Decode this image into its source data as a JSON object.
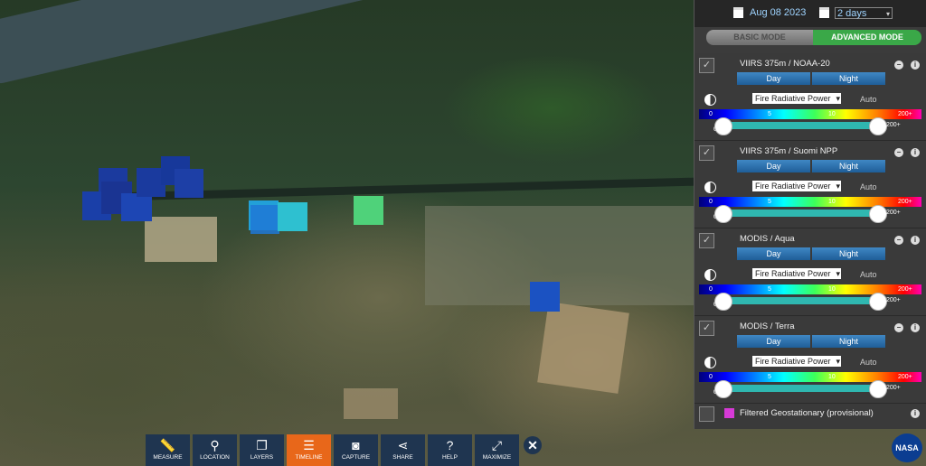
{
  "header": {
    "date": "Aug 08 2023",
    "range": "2 days"
  },
  "modes": {
    "basic": "BASIC MODE",
    "advanced": "ADVANCED MODE"
  },
  "layers": [
    {
      "name": "VIIRS 375m / NOAA-20",
      "day": "Day",
      "night": "Night",
      "metric": "Fire Radiative Power",
      "auto": "Auto",
      "scale": [
        "0",
        "5",
        "10",
        "200+"
      ],
      "slider_min": "0",
      "slider_max": "200+"
    },
    {
      "name": "VIIRS 375m / Suomi NPP",
      "day": "Day",
      "night": "Night",
      "metric": "Fire Radiative Power",
      "auto": "Auto",
      "scale": [
        "0",
        "5",
        "10",
        "200+"
      ],
      "slider_min": "0",
      "slider_max": "200+"
    },
    {
      "name": "MODIS / Aqua",
      "day": "Day",
      "night": "Night",
      "metric": "Fire Radiative Power",
      "auto": "Auto",
      "scale": [
        "0",
        "5",
        "10",
        "200+"
      ],
      "slider_min": "0",
      "slider_max": "200+"
    },
    {
      "name": "MODIS / Terra",
      "day": "Day",
      "night": "Night",
      "metric": "Fire Radiative Power",
      "auto": "Auto",
      "scale": [
        "0",
        "5",
        "10",
        "200+"
      ],
      "slider_min": "0",
      "slider_max": "200+"
    }
  ],
  "filtered_layer": "Filtered Geostationary (provisional)",
  "toolbar": [
    {
      "label": "MEASURE",
      "icon": "ruler-icon"
    },
    {
      "label": "LOCATION",
      "icon": "pin-icon"
    },
    {
      "label": "LAYERS",
      "icon": "layers-icon"
    },
    {
      "label": "TIMELINE",
      "icon": "timeline-icon"
    },
    {
      "label": "CAPTURE",
      "icon": "camera-icon"
    },
    {
      "label": "SHARE",
      "icon": "share-icon"
    },
    {
      "label": "HELP",
      "icon": "help-icon"
    },
    {
      "label": "MAXIMIZE",
      "icon": "maximize-icon"
    }
  ],
  "colors": {
    "active_tool": "#e8671a",
    "advanced_mode": "#3aa848",
    "fire_dark_blue": "#1a3fa8",
    "fire_cyan": "#2ec0d0",
    "fire_green": "#4fd27a",
    "filtered_swatch": "#d63ad6"
  },
  "logo": "NASA"
}
